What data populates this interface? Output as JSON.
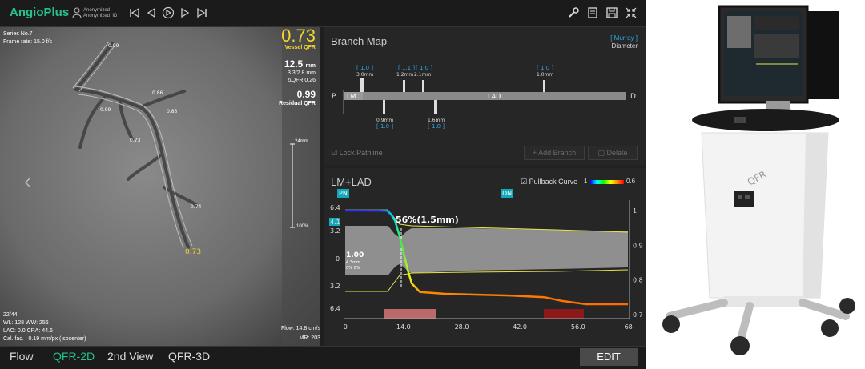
{
  "app": {
    "brand": "AngioPlus",
    "user_line1": "Anonymized",
    "user_line2": "Anonymized_ID"
  },
  "viewer": {
    "series": "Series No.7",
    "frame_rate": "Frame rate: 15.0 f/s",
    "vessel_qfr_value": "0.73",
    "vessel_qfr_label": "Vessel QFR",
    "length_value": "12.5",
    "length_unit": "mm",
    "diameters": "3.3/2.8 mm",
    "delta_qfr": "ΔQFR  0.26",
    "residual_value": "0.99",
    "residual_label": "Residual QFR",
    "scale_top": "24mm",
    "scale_pct": "100%",
    "frame_counter": "22/44",
    "wl_ww": "WL: 128 WW: 256",
    "lao_cra": "LAO: 0.0 CRA: 44.6",
    "cal_fac": "Cal. fac. : 0.19 mm/px (Isocenter)",
    "flow": "Flow: 14.8 cm/s",
    "mr": "MR: 203",
    "vessel_labels": [
      "0.99",
      "0.86",
      "0.99",
      "0.83",
      "0.73",
      "0.74",
      "0.73"
    ]
  },
  "branch_map": {
    "title": "Branch Map",
    "murray": "[ Murray ]",
    "diameter": "Diameter",
    "left_end": "P",
    "right_end": "D",
    "lm": "LM",
    "lad": "LAD",
    "top_markers": [
      {
        "ratio": "[ 1.0 ]",
        "size": "3.0mm"
      },
      {
        "ratio": "[ 1.1 ]",
        "size": "1.2mm"
      },
      {
        "ratio": "[ 1.0 ]",
        "size": "2.1mm"
      },
      {
        "ratio": "[ 1.0 ]",
        "size": "1.0mm"
      }
    ],
    "bottom_markers": [
      {
        "ratio": "[ 1.0 ]",
        "size": "0.9mm"
      },
      {
        "ratio": "[ 1.0 ]",
        "size": "1.6mm"
      }
    ],
    "lock_label": "Lock Pathline",
    "add_branch": "+ Add Branch",
    "delete": "Delete"
  },
  "pullback": {
    "title": "LM+LAD",
    "curve_label": "Pullback Curve",
    "scale_lo": "1",
    "scale_hi": "0.6",
    "pn": "PN",
    "dn": "DN",
    "stenosis": "56%(1.5mm)",
    "cursor_value": "1.00",
    "cursor_sub1": "4.3mm",
    "cursor_sub2": "0% 0%",
    "left_ticks": [
      "6.4",
      "4.1",
      "3.2",
      "0",
      "3.2",
      "6.4"
    ],
    "right_ticks": [
      "1",
      "0.9",
      "0.8",
      "0.7"
    ],
    "x_ticks": [
      "0",
      "14.0",
      "28.0",
      "42.0",
      "56.0",
      "68"
    ]
  },
  "chart_data": {
    "type": "line",
    "title": "LM+LAD",
    "xlabel": "",
    "ylabel": "",
    "xlim": [
      0,
      68
    ],
    "ylim_right": [
      0.7,
      1.0
    ],
    "series": [
      {
        "name": "Pullback Curve",
        "x": [
          0,
          10,
          11,
          12,
          13,
          14,
          15,
          16,
          18,
          24,
          40,
          48,
          52,
          58,
          68
        ],
        "y": [
          1.0,
          1.0,
          0.99,
          0.97,
          0.93,
          0.88,
          0.83,
          0.79,
          0.765,
          0.76,
          0.755,
          0.75,
          0.74,
          0.73,
          0.73
        ]
      }
    ]
  },
  "tabs": [
    "Flow",
    "QFR-2D",
    "2nd View",
    "QFR-3D"
  ],
  "edit_label": "EDIT",
  "colors": {
    "brand": "#27c28a",
    "qfr": "#f5d72a",
    "pn_badge": "#14a7b8"
  }
}
